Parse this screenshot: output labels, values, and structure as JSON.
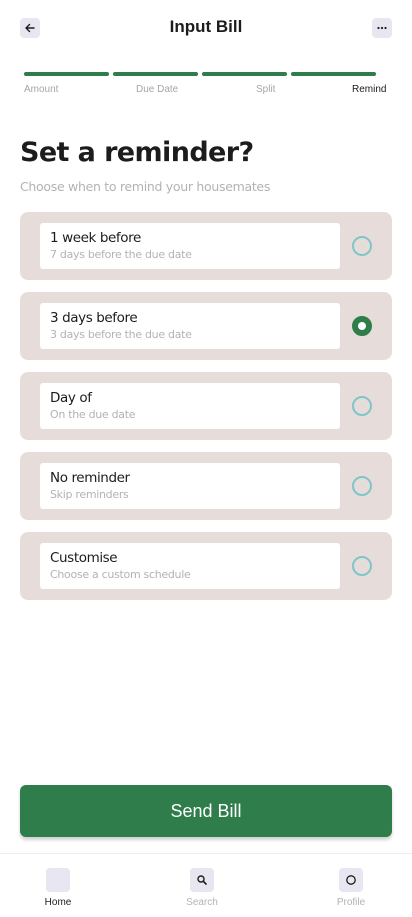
{
  "header": {
    "title": "Input Bill",
    "back_icon": "arrow-left-icon",
    "more_icon": "more-horizontal-icon"
  },
  "stepper": {
    "steps": [
      {
        "label": "Amount",
        "complete": true
      },
      {
        "label": "Due Date",
        "complete": true
      },
      {
        "label": "Split",
        "complete": true
      },
      {
        "label": "Remind",
        "complete": true,
        "active": true
      }
    ]
  },
  "page": {
    "heading": "Set a reminder?",
    "subheading": "Choose when to remind your housemates"
  },
  "options": [
    {
      "label": "1 week before",
      "description": "7 days before the due date",
      "selected": false
    },
    {
      "label": "3 days before",
      "description": "3 days before the due date",
      "selected": true
    },
    {
      "label": "Day of",
      "description": "On the due date",
      "selected": false
    },
    {
      "label": "No reminder",
      "description": "Skip reminders",
      "selected": false
    },
    {
      "label": "Customise",
      "description": "Choose a custom schedule",
      "selected": false
    }
  ],
  "actions": {
    "send_label": "Send Bill"
  },
  "bottom_nav": {
    "items": [
      {
        "label": "Home",
        "icon": "home-icon",
        "active": true
      },
      {
        "label": "Search",
        "icon": "search-icon",
        "active": false
      },
      {
        "label": "Profile",
        "icon": "profile-icon",
        "active": false
      }
    ]
  },
  "colors": {
    "primary": "#2e7d4a",
    "option_bg": "#e6dcda",
    "radio_unselected": "#7fc6c8",
    "muted_text": "#b3b3b3"
  }
}
